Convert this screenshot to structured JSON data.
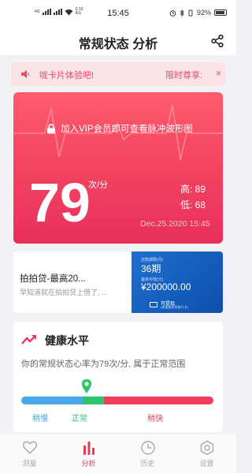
{
  "status_bar": {
    "network": "4G",
    "speed": "0.10",
    "speed_unit": "K/s",
    "time": "15:45",
    "battery": "92%"
  },
  "header": {
    "title": "常规状态 分析"
  },
  "banner": {
    "text": "咙卡片体验吧!",
    "cta": "限时尊享:",
    "close": "×"
  },
  "heart_card": {
    "vip_text": "加入VIP会员即可查看脉冲波形图",
    "bpm": "79",
    "unit": "次/分",
    "high": "高: 89",
    "low": "低: 68",
    "timestamp": "Dec.25.2020 15:45"
  },
  "ad": {
    "title": "拍拍贷-最高20...",
    "desc": "早知道就在拍拍贷上借了, ...",
    "term_label": "还款期限(月)",
    "term_value": "36期",
    "amount_label": "最高可借(元)",
    "amount_value": "¥200000.00",
    "cta": "可提现",
    "cta_sub": "(快速放款到银行卡)"
  },
  "health": {
    "title": "健康水平",
    "description": "你的常规状态心率为79次/分, 属于正常范围",
    "current_value_fraction": 0.34,
    "ranges": [
      {
        "label": "稍慢",
        "color": "#4aa8e8"
      },
      {
        "label": "正常",
        "color": "#2ec46b"
      },
      {
        "label": "稍快",
        "color": "#ef3e5c"
      }
    ]
  },
  "tabs": [
    {
      "label": "测量",
      "icon": "heart-icon",
      "active": false
    },
    {
      "label": "分析",
      "icon": "chart-icon",
      "active": true
    },
    {
      "label": "历史",
      "icon": "clock-icon",
      "active": false
    },
    {
      "label": "设置",
      "icon": "gear-icon",
      "active": false
    }
  ]
}
